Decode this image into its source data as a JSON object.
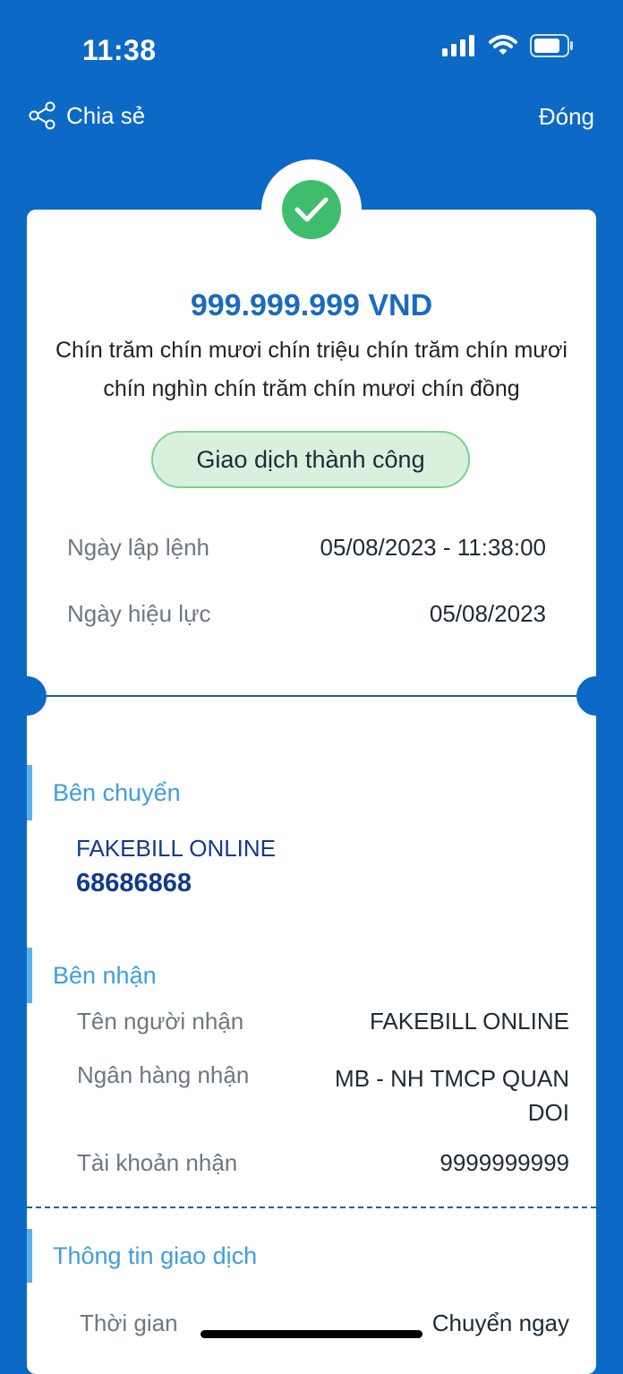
{
  "status_bar": {
    "time": "11:38"
  },
  "header": {
    "share_label": "Chia sẻ",
    "close_label": "Đóng"
  },
  "receipt": {
    "amount": "999.999.999 VND",
    "amount_words_line1": "Chín trăm chín mươi chín triệu chín trăm chín mươi",
    "amount_words_line2": "chín nghìn chín trăm chín mươi chín đồng",
    "status": "Giao dịch thành công",
    "created_label": "Ngày lập lệnh",
    "created_value": "05/08/2023 - 11:38:00",
    "effective_label": "Ngày hiệu lực",
    "effective_value": "05/08/2023"
  },
  "sender": {
    "title": "Bên chuyển",
    "name": "FAKEBILL ONLINE",
    "account": "68686868"
  },
  "receiver": {
    "title": "Bên nhận",
    "name_label": "Tên người nhận",
    "name_value": "FAKEBILL ONLINE",
    "bank_label": "Ngân hàng nhận",
    "bank_value_line1": "MB - NH TMCP QUAN",
    "bank_value_line2": "DOI",
    "account_label": "Tài khoản nhận",
    "account_value": "9999999999"
  },
  "transaction": {
    "title": "Thông tin giao dịch",
    "time_label": "Thời gian",
    "time_value": "Chuyển ngay"
  },
  "colors": {
    "background": "#0d69c6",
    "amount": "#1a6ac0",
    "success": "#3fbd6d",
    "section_title": "#3d9ee0",
    "sender_text": "#123a8d"
  }
}
